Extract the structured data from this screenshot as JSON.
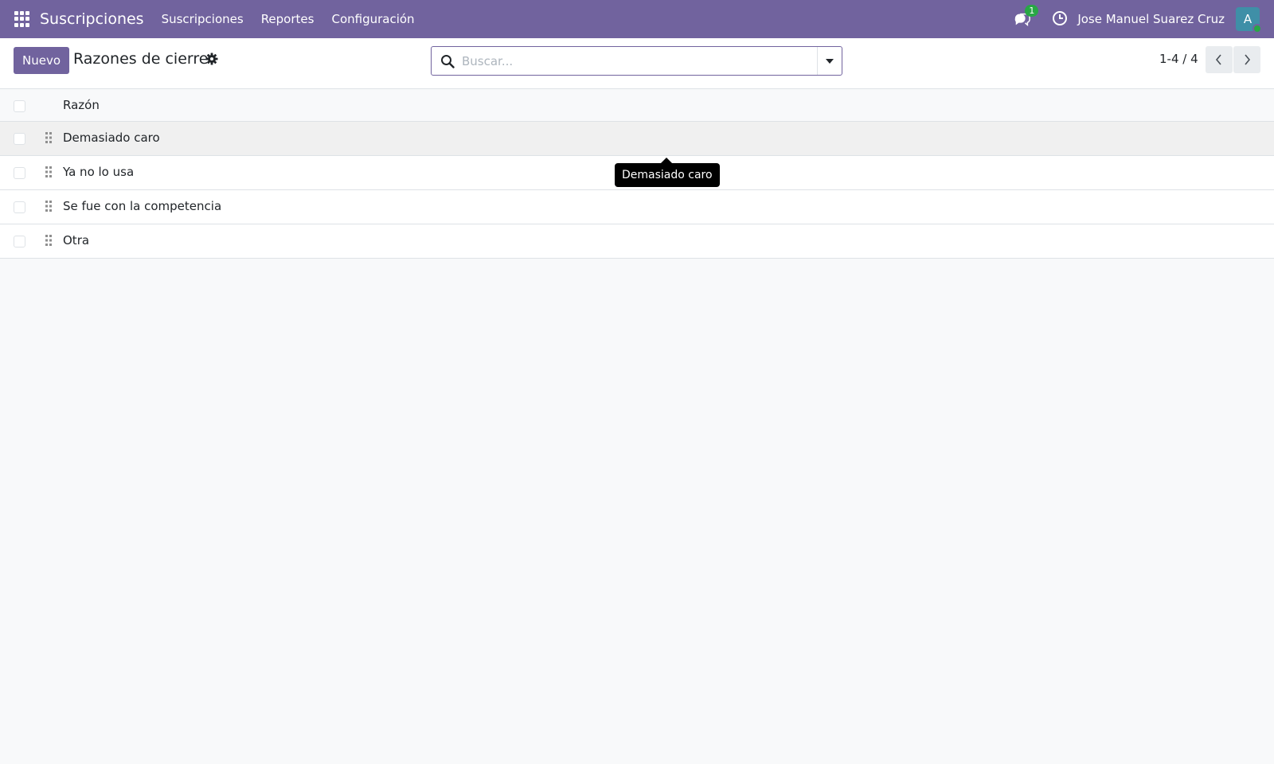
{
  "navbar": {
    "app_name": "Suscripciones",
    "menu": [
      {
        "label": "Suscripciones"
      },
      {
        "label": "Reportes"
      },
      {
        "label": "Configuración"
      }
    ],
    "messages_badge": "1",
    "user_name": "Jose Manuel Suarez Cruz",
    "avatar_initial": "A"
  },
  "control_panel": {
    "new_button": "Nuevo",
    "title": "Razones de cierre",
    "search_placeholder": "Buscar...",
    "pager": "1-4 / 4"
  },
  "list": {
    "column_header": "Razón",
    "rows": [
      {
        "name": "Demasiado caro"
      },
      {
        "name": "Ya no lo usa"
      },
      {
        "name": "Se fue con la competencia"
      },
      {
        "name": "Otra"
      }
    ]
  },
  "tooltip": {
    "text": "Demasiado caro"
  },
  "colors": {
    "navbar": "#71639e",
    "primary": "#71639e",
    "badge": "#28a745",
    "avatar": "#3f8fa7"
  }
}
